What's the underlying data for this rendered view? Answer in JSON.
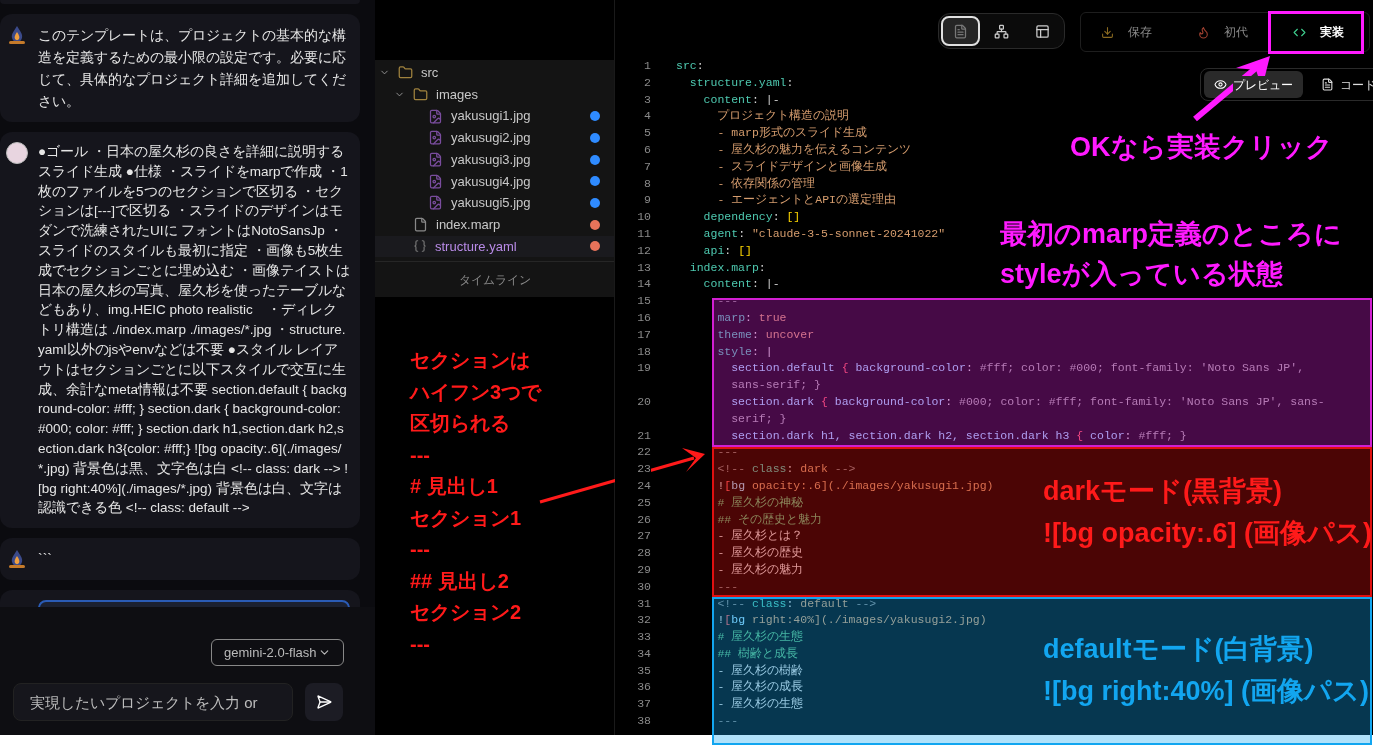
{
  "chat": {
    "messages": [
      {
        "kind": "bot",
        "text": "このテンプレートは、プロジェクトの基本的な構造を定義するための最小限の設定です。必要に応じて、具体的なプロジェクト詳細を追加してください。"
      },
      {
        "kind": "user",
        "text": "●ゴール ・日本の屋久杉の良さを詳細に説明するスライド生成 ●仕様 ・スライドをmarpで作成 ・1枚のファイルを5つのセクションで区切る ・セクションは[---]で区切る ・スライドのデザインはモダンで洗練されたUIに フォントはNotoSansJp ・スライドのスタイルも最初に指定 ・画像も5枚生成でセクションごとに埋め込む ・画像テイストは日本の屋久杉の写真、屋久杉を使ったテーブルなどもあり、img.HEIC photo realistic　・ディレクトリ構造は ./index.marp ./images/*.jpg ・structure.yaml以外のjsやenvなどは不要 ●スタイル レイアウトはセクションごとに以下スタイルで交互に生成、余計なmeta情報は不要 section.default { background-color: #fff; } section.dark { background-color: #000; color: #fff; } section.dark h1,section.dark h2,section.dark h3{color: #fff;} ![bg opacity:.6](./images/*.jpg) 背景色は黒、文字色は白 <!-- class: dark --> ![bg right:40%](./images/*.jpg) 背景色は白、文字は認識できる色 <!-- class: default -->"
      },
      {
        "kind": "bot",
        "text": "```"
      },
      {
        "kind": "draft"
      }
    ],
    "model_select": {
      "value": "gemini-2.0-flash"
    },
    "prompt": {
      "placeholder": "実現したいプロジェクトを入力 or"
    }
  },
  "file_tree": {
    "items": [
      {
        "name": "src",
        "kind": "folder",
        "expanded": true,
        "selected": false,
        "children": [
          {
            "name": "images",
            "kind": "folder",
            "expanded": true,
            "selected": false,
            "children": [
              {
                "name": "yakusugi1.jpg",
                "kind": "image",
                "selected": false,
                "color": "#2f8bff"
              },
              {
                "name": "yakusugi2.jpg",
                "kind": "image",
                "selected": false,
                "color": "#2f8bff"
              },
              {
                "name": "yakusugi3.jpg",
                "kind": "image",
                "selected": false,
                "color": "#2f8bff"
              },
              {
                "name": "yakusugi4.jpg",
                "kind": "image",
                "selected": false,
                "color": "#2f8bff"
              },
              {
                "name": "yakusugi5.jpg",
                "kind": "image",
                "selected": false,
                "color": "#2f8bff"
              }
            ]
          },
          {
            "name": "index.marp",
            "kind": "file",
            "selected": false,
            "color": "#e8735a"
          },
          {
            "name": "structure.yaml",
            "kind": "data",
            "selected": true,
            "color": "#e8735a"
          }
        ]
      }
    ],
    "footer": "タイムライン"
  },
  "view_switch": [
    {
      "kind": "file",
      "selected": true
    },
    {
      "kind": "tree",
      "selected": false
    },
    {
      "kind": "layout",
      "selected": false
    }
  ],
  "actions": [
    {
      "kind": "save",
      "label": "保存"
    },
    {
      "kind": "fire",
      "label": "初代"
    },
    {
      "kind": "code",
      "label": "実装"
    }
  ],
  "editor_tabs": [
    {
      "kind": "preview",
      "label": "プレビュー",
      "selected": true
    },
    {
      "kind": "code",
      "label": "コード",
      "selected": false
    }
  ],
  "code": {
    "lines": [
      {
        "num": "1",
        "parts": [
          {
            "kind": "key",
            "text": "src"
          },
          {
            "kind": "punct",
            "text": ":"
          }
        ]
      },
      {
        "num": "2",
        "parts": [
          {
            "kind": "key",
            "text": "  structure.yaml"
          },
          {
            "kind": "punct",
            "text": ":"
          }
        ]
      },
      {
        "num": "3",
        "parts": [
          {
            "kind": "key",
            "text": "    content"
          },
          {
            "kind": "punct",
            "text": ": |-"
          }
        ]
      },
      {
        "num": "4",
        "parts": [
          {
            "kind": "str",
            "text": "      プロジェクト構造の説明"
          }
        ]
      },
      {
        "num": "5",
        "parts": [
          {
            "kind": "str",
            "text": "      - marp形式のスライド生成"
          }
        ]
      },
      {
        "num": "6",
        "parts": [
          {
            "kind": "str",
            "text": "      - 屋久杉の魅力を伝えるコンテンツ"
          }
        ]
      },
      {
        "num": "7",
        "parts": [
          {
            "kind": "str",
            "text": "      - スライドデザインと画像生成"
          }
        ]
      },
      {
        "num": "8",
        "parts": [
          {
            "kind": "str",
            "text": "      - 依存関係の管理"
          }
        ]
      },
      {
        "num": "9",
        "parts": [
          {
            "kind": "str",
            "text": "      - エージェントとAPIの選定理由"
          }
        ]
      },
      {
        "num": "10",
        "parts": [
          {
            "kind": "key",
            "text": "    dependency"
          },
          {
            "kind": "punct",
            "text": ": "
          },
          {
            "kind": "bracket",
            "text": "[]"
          }
        ]
      },
      {
        "num": "11",
        "parts": [
          {
            "kind": "key",
            "text": "    agent"
          },
          {
            "kind": "punct",
            "text": ": "
          },
          {
            "kind": "str",
            "text": "\"claude-3-5-sonnet-20241022\""
          }
        ]
      },
      {
        "num": "12",
        "parts": [
          {
            "kind": "key",
            "text": "    api"
          },
          {
            "kind": "punct",
            "text": ": "
          },
          {
            "kind": "bracket",
            "text": "[]"
          }
        ]
      },
      {
        "num": "13",
        "parts": [
          {
            "kind": "key",
            "text": "  index.marp"
          },
          {
            "kind": "punct",
            "text": ":"
          }
        ]
      },
      {
        "num": "14",
        "parts": [
          {
            "kind": "key",
            "text": "    content"
          },
          {
            "kind": "punct",
            "text": ": |-"
          }
        ]
      },
      {
        "num": "15",
        "parts": [
          {
            "kind": "dash",
            "text": "      ---"
          }
        ]
      },
      {
        "num": "16",
        "parts": [
          {
            "kind": "key",
            "text": "      marp"
          },
          {
            "kind": "punct",
            "text": ": "
          },
          {
            "kind": "str",
            "text": "true"
          }
        ]
      },
      {
        "num": "17",
        "parts": [
          {
            "kind": "key",
            "text": "      theme"
          },
          {
            "kind": "punct",
            "text": ": "
          },
          {
            "kind": "str",
            "text": "uncover"
          }
        ]
      },
      {
        "num": "18",
        "parts": [
          {
            "kind": "key",
            "text": "      style"
          },
          {
            "kind": "punct",
            "text": ": |"
          }
        ]
      },
      {
        "num": "19",
        "parts": [
          {
            "kind": "sel",
            "text": "        section.default"
          },
          {
            "kind": "brace",
            "text": " { "
          },
          {
            "kind": "prop",
            "text": "background-color"
          },
          {
            "kind": "punct",
            "text": ": "
          },
          {
            "kind": "val",
            "text": "#fff; color: #000; font-family: 'Noto Sans JP', sans-serif; }"
          }
        ]
      },
      {
        "num": "20",
        "parts": [
          {
            "kind": "sel",
            "text": "        section.dark"
          },
          {
            "kind": "brace",
            "text": " { "
          },
          {
            "kind": "prop",
            "text": "background-color"
          },
          {
            "kind": "punct",
            "text": ": "
          },
          {
            "kind": "val",
            "text": "#000; color: #fff; font-family: 'Noto Sans JP', sans-serif; }"
          }
        ]
      },
      {
        "num": "21",
        "parts": [
          {
            "kind": "sel",
            "text": "        section.dark h1, section.dark h2, section.dark h3"
          },
          {
            "kind": "brace",
            "text": " { "
          },
          {
            "kind": "prop",
            "text": "color"
          },
          {
            "kind": "punct",
            "text": ": "
          },
          {
            "kind": "val",
            "text": "#fff; }"
          }
        ]
      },
      {
        "num": "22",
        "parts": [
          {
            "kind": "dash",
            "text": "      ---"
          }
        ]
      },
      {
        "num": "23",
        "parts": [
          {
            "kind": "cmt",
            "text": "      <!-- "
          },
          {
            "kind": "key",
            "text": "class"
          },
          {
            "kind": "punct",
            "text": ": "
          },
          {
            "kind": "str",
            "text": "dark"
          },
          {
            "kind": "cmt",
            "text": " -->"
          }
        ]
      },
      {
        "num": "24",
        "parts": [
          {
            "kind": "punct",
            "text": "      !"
          },
          {
            "kind": "brace",
            "text": "["
          },
          {
            "kind": "sel",
            "text": "bg"
          },
          {
            "kind": "str",
            "text": " opacity:.6](./images/yakusugi1.jpg)"
          }
        ]
      },
      {
        "num": "25",
        "parts": [
          {
            "kind": "head",
            "text": "      # 屋久杉の神秘"
          }
        ]
      },
      {
        "num": "26",
        "parts": [
          {
            "kind": "head",
            "text": "      ## その歴史と魅力"
          }
        ]
      },
      {
        "num": "27",
        "parts": [
          {
            "kind": "plain",
            "text": "      - 屋久杉とは？"
          }
        ]
      },
      {
        "num": "28",
        "parts": [
          {
            "kind": "plain",
            "text": "      - 屋久杉の歴史"
          }
        ]
      },
      {
        "num": "29",
        "parts": [
          {
            "kind": "plain",
            "text": "      - 屋久杉の魅力"
          }
        ]
      },
      {
        "num": "30",
        "parts": [
          {
            "kind": "dash",
            "text": "      ---"
          }
        ]
      },
      {
        "num": "31",
        "parts": [
          {
            "kind": "cmt",
            "text": "      <!-- "
          },
          {
            "kind": "key",
            "text": "class"
          },
          {
            "kind": "punct",
            "text": ": "
          },
          {
            "kind": "str",
            "text": "default"
          },
          {
            "kind": "cmt",
            "text": " -->"
          }
        ]
      },
      {
        "num": "32",
        "parts": [
          {
            "kind": "punct",
            "text": "      !"
          },
          {
            "kind": "brace",
            "text": "["
          },
          {
            "kind": "sel",
            "text": "bg"
          },
          {
            "kind": "str",
            "text": " right:40%](./images/yakusugi2.jpg)"
          }
        ]
      },
      {
        "num": "33",
        "parts": [
          {
            "kind": "head",
            "text": "      # 屋久杉の生態"
          }
        ]
      },
      {
        "num": "34",
        "parts": [
          {
            "kind": "head",
            "text": "      ## 樹齢と成長"
          }
        ]
      },
      {
        "num": "35",
        "parts": [
          {
            "kind": "plain",
            "text": "      - 屋久杉の樹齢"
          }
        ]
      },
      {
        "num": "36",
        "parts": [
          {
            "kind": "plain",
            "text": "      - 屋久杉の成長"
          }
        ]
      },
      {
        "num": "37",
        "parts": [
          {
            "kind": "plain",
            "text": "      - 屋久杉の生態"
          }
        ]
      },
      {
        "num": "38",
        "parts": [
          {
            "kind": "dash",
            "text": "      ---"
          }
        ]
      }
    ]
  },
  "annotations": {
    "regions": [
      {
        "color": "#d21fd2"
      },
      {
        "color": "#e01010"
      },
      {
        "color": "#12a6f0"
      }
    ],
    "frame": {
      "color": "#ff1aff"
    },
    "arrows": [
      {
        "color": "#ff1aff"
      },
      {
        "color": "#ff1a1a"
      }
    ],
    "notes": [
      {
        "color": "#ff1aff",
        "lines": [
          "OKなら実装クリック"
        ]
      },
      {
        "color": "#ff1aff",
        "lines": [
          "最初のmarp定義のところに",
          "styleが入っている状態"
        ]
      },
      {
        "color": "#ff1a1a",
        "lines": [
          "セクションは",
          "ハイフン3つで",
          "区切られる",
          "---",
          "# 見出し1",
          "セクション1",
          "---",
          "## 見出し2",
          "セクション2",
          "---"
        ]
      },
      {
        "color": "#ff1a1a",
        "lines": [
          "darkモード(黒背景)",
          "![bg opacity:.6] (画像パス)"
        ]
      },
      {
        "color": "#12a6f0",
        "lines": [
          "defaultモード(白背景)",
          "![bg right:40%] (画像パス)"
        ]
      }
    ]
  }
}
